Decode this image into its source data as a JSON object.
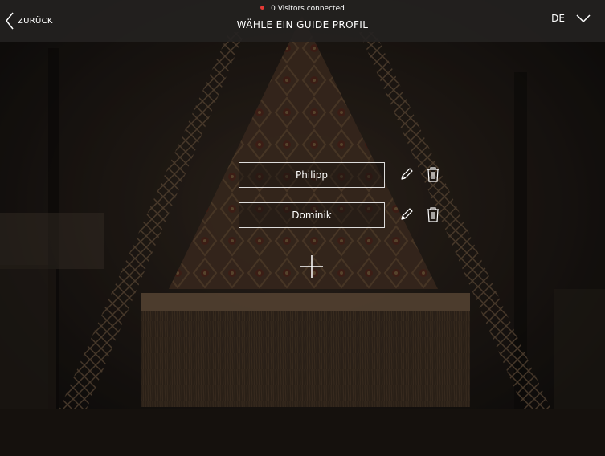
{
  "header": {
    "back_label": "ZURÜCK",
    "status_text": "0 Visitors connected",
    "status_color": "#e53935",
    "title": "WÄHLE EIN GUIDE PROFIL",
    "language": "DE"
  },
  "profiles": [
    {
      "name": "Philipp"
    },
    {
      "name": "Dominik"
    }
  ],
  "icons": {
    "back": "chevron-left-icon",
    "language": "chevron-down-icon",
    "edit": "pencil-icon",
    "delete": "trash-icon",
    "add": "plus-icon"
  }
}
